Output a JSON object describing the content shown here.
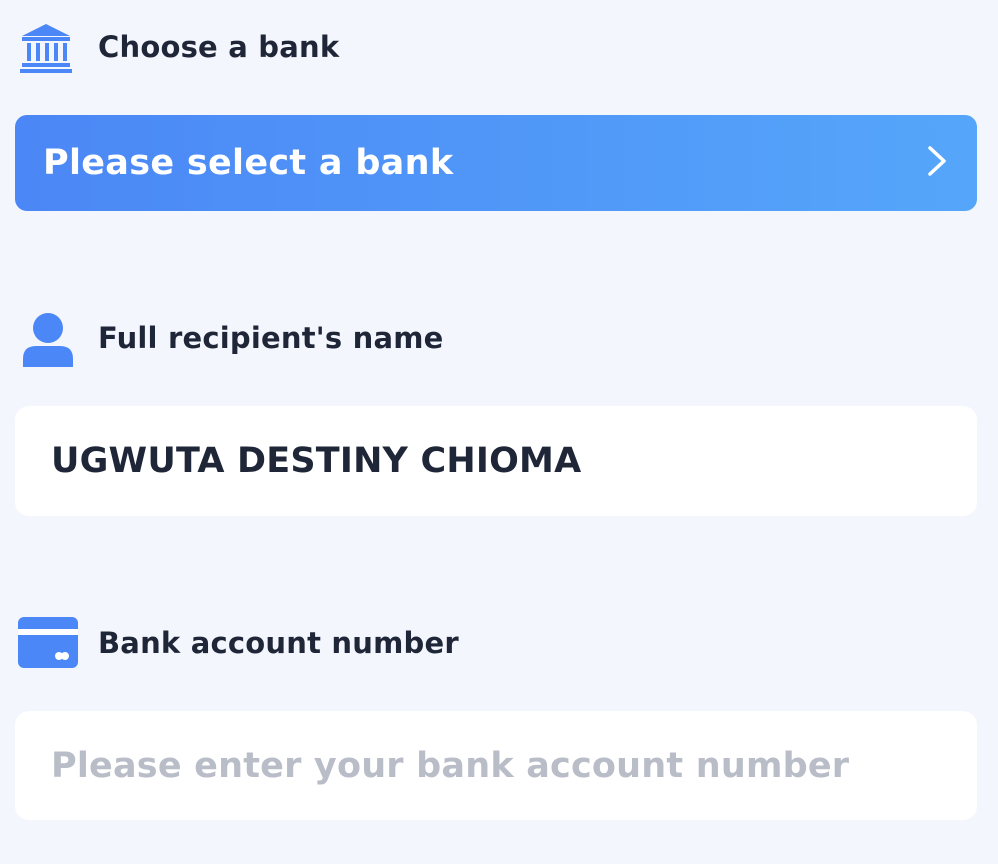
{
  "bank_section": {
    "label": "Choose a bank",
    "icon": "bank-icon",
    "select_placeholder": "Please select a bank",
    "arrow_icon": "chevron-right-icon"
  },
  "recipient_section": {
    "label": "Full recipient's name",
    "icon": "person-icon",
    "value": "UGWUTA DESTINY CHIOMA"
  },
  "account_section": {
    "label": "Bank account number",
    "icon": "card-icon",
    "placeholder": "Please enter your bank account number",
    "value": ""
  },
  "colors": {
    "accent": "#4b87f6",
    "accent_light": "#55a6fa",
    "background": "#f4f6fd",
    "text": "#1f2637",
    "placeholder": "#b9bdc8"
  }
}
